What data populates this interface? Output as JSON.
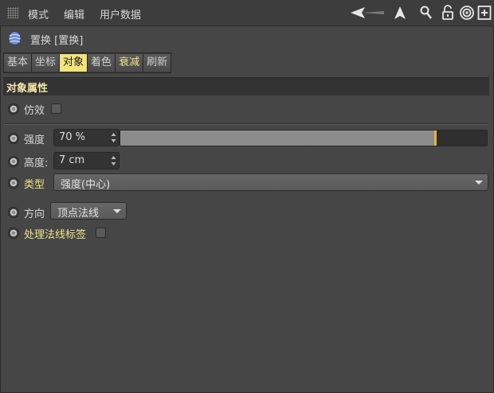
{
  "menubar": {
    "items": [
      "模式",
      "编辑",
      "用户数据"
    ],
    "tools": [
      "back-arrow-icon",
      "up-arrow-icon",
      "search-icon",
      "lock-icon",
      "target-icon",
      "new-panel-icon"
    ]
  },
  "object": {
    "icon": "displacer-icon",
    "title": "置换 [置换]"
  },
  "tabs": [
    {
      "label": "基本",
      "active": false
    },
    {
      "label": "坐标",
      "active": false
    },
    {
      "label": "对象",
      "active": true
    },
    {
      "label": "着色",
      "active": false
    },
    {
      "label": "衰减",
      "active": false
    },
    {
      "label": "刷新",
      "active": false
    }
  ],
  "section": {
    "title": "对象属性"
  },
  "fields": {
    "emulation": {
      "label": "仿效",
      "checked": false
    },
    "strength": {
      "label": "强度",
      "value": "70 %",
      "fraction": 0.7
    },
    "height": {
      "label": "高度:",
      "value": "7 cm"
    },
    "type": {
      "label": "类型",
      "value": "强度(中心)"
    },
    "direction": {
      "label": "方向",
      "value": "顶点法线"
    },
    "normal_tag": {
      "label": "处理法线标签",
      "checked": false
    }
  },
  "colors": {
    "active_tab": "#f3e37a",
    "accent_label": "#f0e48a",
    "slider_knob": "#e8b23a"
  }
}
